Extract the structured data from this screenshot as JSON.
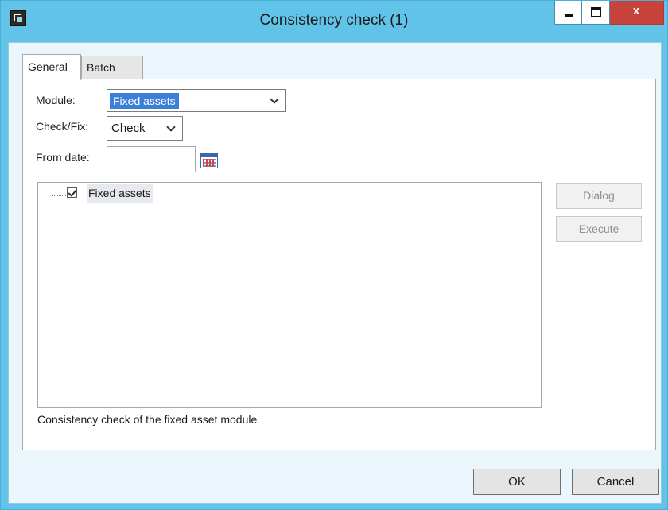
{
  "window": {
    "title": "Consistency check (1)",
    "app_icon": "dynamics-ax-icon",
    "controls": {
      "minimize": "minimize-icon",
      "maximize": "maximize-icon",
      "close_label": "x"
    }
  },
  "tabs": [
    {
      "label": "General",
      "selected": true
    },
    {
      "label": "Batch",
      "selected": false
    }
  ],
  "form": {
    "module_label": "Module:",
    "module_value": "Fixed assets",
    "checkfix_label": "Check/Fix:",
    "checkfix_value": "Check",
    "fromdate_label": "From date:",
    "fromdate_value": "",
    "calendar_icon": "calendar-icon"
  },
  "tree": {
    "items": [
      {
        "label": "Fixed assets",
        "checked": true
      }
    ]
  },
  "side_buttons": {
    "dialog": "Dialog",
    "execute": "Execute"
  },
  "description": "Consistency check of the fixed asset module",
  "footer": {
    "ok": "OK",
    "cancel": "Cancel"
  },
  "colors": {
    "titlebar": "#62c3e8",
    "client": "#eaf6fb",
    "selection": "#3c7fd8",
    "close": "#c7433b"
  }
}
